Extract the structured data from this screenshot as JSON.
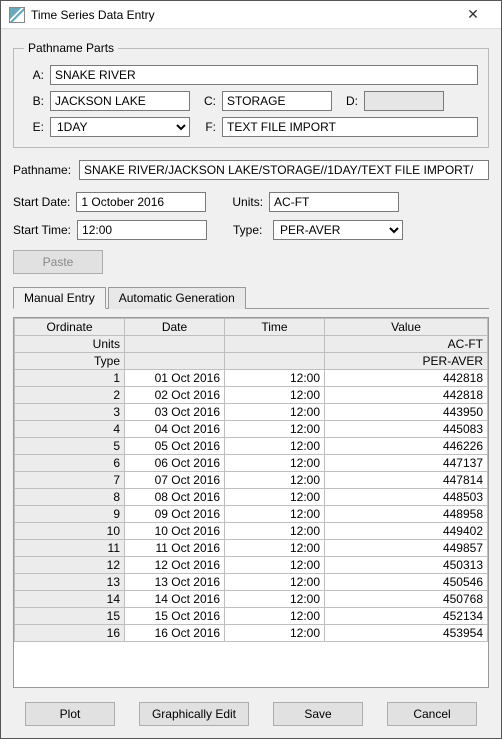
{
  "window": {
    "title": "Time Series Data Entry"
  },
  "pathname_parts": {
    "legend": "Pathname Parts",
    "a_label": "A:",
    "a": "SNAKE RIVER",
    "b_label": "B:",
    "b": "JACKSON LAKE",
    "c_label": "C:",
    "c": "STORAGE",
    "d_label": "D:",
    "d": "",
    "e_label": "E:",
    "e": "1DAY",
    "f_label": "F:",
    "f": "TEXT FILE IMPORT"
  },
  "pathname": {
    "label": "Pathname:",
    "value": "SNAKE RIVER/JACKSON LAKE/STORAGE//1DAY/TEXT FILE IMPORT/"
  },
  "start_date": {
    "label": "Start Date:",
    "value": "1 October 2016"
  },
  "start_time": {
    "label": "Start Time:",
    "value": "12:00"
  },
  "units": {
    "label": "Units:",
    "value": "AC-FT"
  },
  "type": {
    "label": "Type:",
    "value": "PER-AVER"
  },
  "buttons": {
    "paste": "Paste",
    "plot": "Plot",
    "graph_edit": "Graphically Edit",
    "save": "Save",
    "cancel": "Cancel"
  },
  "tabs": {
    "manual": "Manual Entry",
    "auto": "Automatic Generation"
  },
  "grid": {
    "headers": {
      "ordinate": "Ordinate",
      "date": "Date",
      "time": "Time",
      "value": "Value"
    },
    "meta_rows": [
      {
        "label": "Units",
        "value": "AC-FT"
      },
      {
        "label": "Type",
        "value": "PER-AVER"
      }
    ],
    "rows": [
      {
        "n": 1,
        "date": "01 Oct 2016",
        "time": "12:00",
        "value": 442818
      },
      {
        "n": 2,
        "date": "02 Oct 2016",
        "time": "12:00",
        "value": 442818
      },
      {
        "n": 3,
        "date": "03 Oct 2016",
        "time": "12:00",
        "value": 443950
      },
      {
        "n": 4,
        "date": "04 Oct 2016",
        "time": "12:00",
        "value": 445083
      },
      {
        "n": 5,
        "date": "05 Oct 2016",
        "time": "12:00",
        "value": 446226
      },
      {
        "n": 6,
        "date": "06 Oct 2016",
        "time": "12:00",
        "value": 447137
      },
      {
        "n": 7,
        "date": "07 Oct 2016",
        "time": "12:00",
        "value": 447814
      },
      {
        "n": 8,
        "date": "08 Oct 2016",
        "time": "12:00",
        "value": 448503
      },
      {
        "n": 9,
        "date": "09 Oct 2016",
        "time": "12:00",
        "value": 448958
      },
      {
        "n": 10,
        "date": "10 Oct 2016",
        "time": "12:00",
        "value": 449402
      },
      {
        "n": 11,
        "date": "11 Oct 2016",
        "time": "12:00",
        "value": 449857
      },
      {
        "n": 12,
        "date": "12 Oct 2016",
        "time": "12:00",
        "value": 450313
      },
      {
        "n": 13,
        "date": "13 Oct 2016",
        "time": "12:00",
        "value": 450546
      },
      {
        "n": 14,
        "date": "14 Oct 2016",
        "time": "12:00",
        "value": 450768
      },
      {
        "n": 15,
        "date": "15 Oct 2016",
        "time": "12:00",
        "value": 452134
      },
      {
        "n": 16,
        "date": "16 Oct 2016",
        "time": "12:00",
        "value": 453954
      }
    ]
  }
}
